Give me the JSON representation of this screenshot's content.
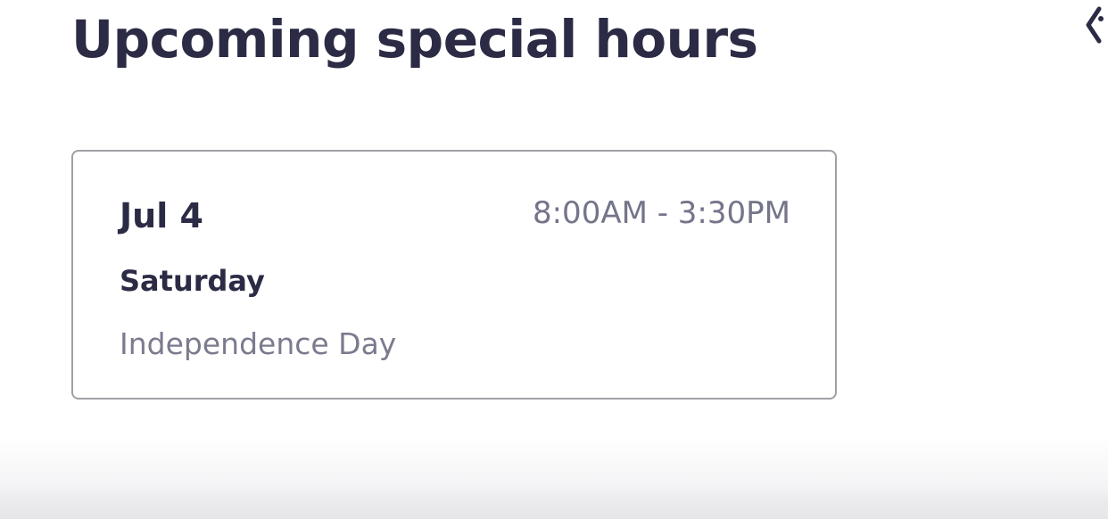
{
  "section": {
    "title": "Upcoming special hours",
    "edge_icon": "tag-icon"
  },
  "special_hours": [
    {
      "date": "Jul 4",
      "weekday": "Saturday",
      "holiday": "Independence Day",
      "hours": "8:00AM - 3:30PM"
    }
  ],
  "colors": {
    "heading": "#2b2b45",
    "muted_text": "#74748a",
    "card_border": "#a0a0a6",
    "background": "#ffffff"
  }
}
